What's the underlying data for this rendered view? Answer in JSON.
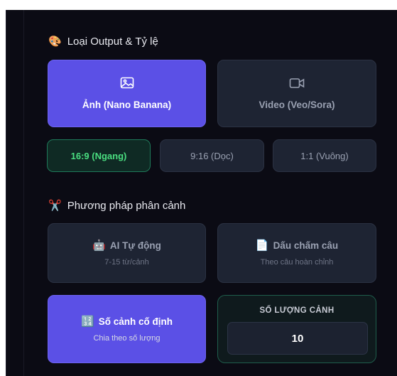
{
  "output_section": {
    "emoji": "🎨",
    "title": "Loại Output & Tỷ lệ",
    "options": [
      {
        "label": "Ảnh (Nano Banana)",
        "icon": "image-icon"
      },
      {
        "label": "Video (Veo/Sora)",
        "icon": "video-icon"
      }
    ],
    "ratios": [
      "16:9 (Ngang)",
      "9:16 (Dọc)",
      "1:1 (Vuông)"
    ]
  },
  "scene_section": {
    "emoji": "✂️",
    "title": "Phương pháp phân cảnh",
    "methods": [
      {
        "emoji": "🤖",
        "label": "AI Tự động",
        "sub": "7-15 từ/cảnh"
      },
      {
        "emoji": "📄",
        "label": "Dấu chấm câu",
        "sub": "Theo câu hoàn chỉnh"
      },
      {
        "emoji": "🔢",
        "label": "Số cảnh cố định",
        "sub": "Chia theo số lượng"
      }
    ],
    "count_label": "SỐ LƯỢNG CẢNH",
    "count_value": "10"
  },
  "colors": {
    "accent": "#5b50e6",
    "ratio_selected": "#4ade80",
    "panel_bg": "#0b0b14",
    "button_bg": "#1e2433"
  }
}
